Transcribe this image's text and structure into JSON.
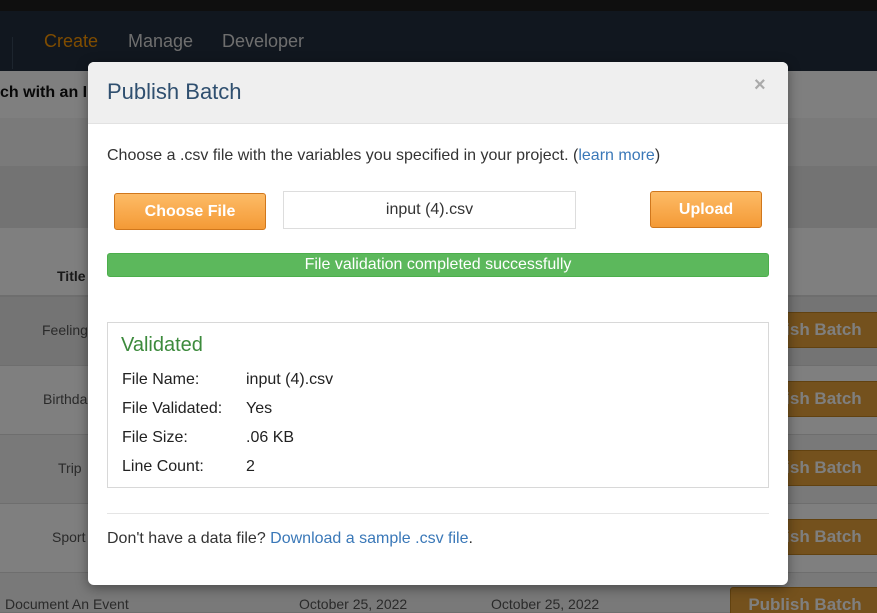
{
  "background": {
    "nav": {
      "create": "Create",
      "manage": "Manage",
      "developer": "Developer"
    },
    "heading": "ch with an I",
    "table": {
      "title_header": "Title",
      "rows": [
        {
          "title": "Feeling",
          "button": "Publish Batch"
        },
        {
          "title": "Birthda",
          "button": "Publish Batch"
        },
        {
          "title": "Trip",
          "button": "Publish Batch"
        },
        {
          "title": "Sport",
          "button": "Publish Batch"
        },
        {
          "title": "Document An Event",
          "button": "Publish Batch",
          "date1": "October 25, 2022",
          "date2": "October 25, 2022"
        }
      ]
    }
  },
  "modal": {
    "title": "Publish Batch",
    "close": "×",
    "instruction": "Choose a .csv file with the variables you specified in your project. (",
    "learn_more": "learn more",
    "instruction_end": ")",
    "choose_file": "Choose File",
    "file_name_value": "input (4).csv",
    "upload": "Upload",
    "progress_text": "File validation completed successfully",
    "progress_fraction": 1.0,
    "validated": {
      "heading": "Validated",
      "rows": [
        {
          "label": "File Name:",
          "value": "input (4).csv"
        },
        {
          "label": "File Validated:",
          "value": "Yes"
        },
        {
          "label": "File Size:",
          "value": ".06 KB"
        },
        {
          "label": "Line Count:",
          "value": "2"
        }
      ]
    },
    "footer_text": "Don't have a data file? ",
    "footer_link": "Download a sample .csv file",
    "footer_end": "."
  },
  "colors": {
    "accent_orange": "#f49a36",
    "success_green": "#5cb85c",
    "link_blue": "#3a78b8",
    "nav_bg": "#232f3e"
  }
}
